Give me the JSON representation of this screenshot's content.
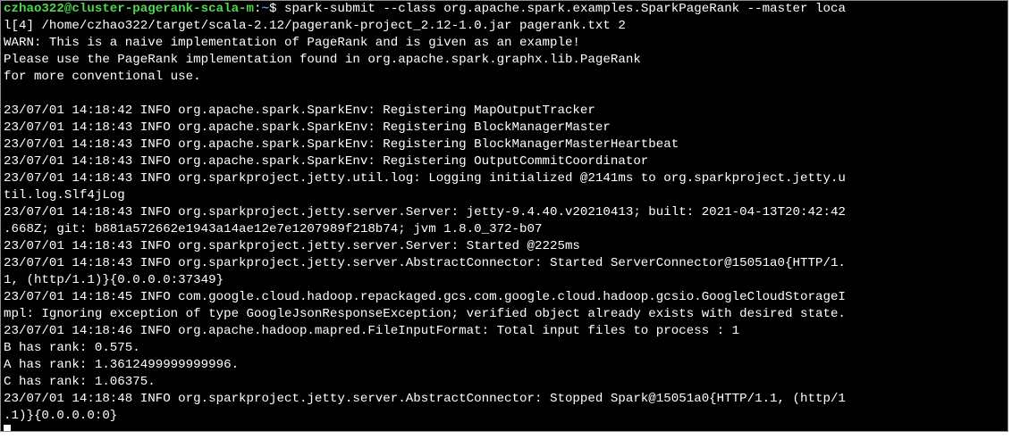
{
  "terminal": {
    "prompt_user_host": "czhao322@cluster-pagerank-scala-m",
    "prompt_sep": ":",
    "prompt_path": "~",
    "prompt_symbol": "$ ",
    "command": "spark-submit --class org.apache.spark.examples.SparkPageRank --master loca",
    "lines": [
      "l[4] /home/czhao322/target/scala-2.12/pagerank-project_2.12-1.0.jar pagerank.txt 2",
      "WARN: This is a naive implementation of PageRank and is given as an example!",
      "Please use the PageRank implementation found in org.apache.spark.graphx.lib.PageRank",
      "for more conventional use.",
      "",
      "23/07/01 14:18:42 INFO org.apache.spark.SparkEnv: Registering MapOutputTracker",
      "23/07/01 14:18:43 INFO org.apache.spark.SparkEnv: Registering BlockManagerMaster",
      "23/07/01 14:18:43 INFO org.apache.spark.SparkEnv: Registering BlockManagerMasterHeartbeat",
      "23/07/01 14:18:43 INFO org.apache.spark.SparkEnv: Registering OutputCommitCoordinator",
      "23/07/01 14:18:43 INFO org.sparkproject.jetty.util.log: Logging initialized @2141ms to org.sparkproject.jetty.u",
      "til.log.Slf4jLog",
      "23/07/01 14:18:43 INFO org.sparkproject.jetty.server.Server: jetty-9.4.40.v20210413; built: 2021-04-13T20:42:42",
      ".668Z; git: b881a572662e1943a14ae12e7e1207989f218b74; jvm 1.8.0_372-b07",
      "23/07/01 14:18:43 INFO org.sparkproject.jetty.server.Server: Started @2225ms",
      "23/07/01 14:18:43 INFO org.sparkproject.jetty.server.AbstractConnector: Started ServerConnector@15051a0{HTTP/1.",
      "1, (http/1.1)}{0.0.0.0:37349}",
      "23/07/01 14:18:45 INFO com.google.cloud.hadoop.repackaged.gcs.com.google.cloud.hadoop.gcsio.GoogleCloudStorageI",
      "mpl: Ignoring exception of type GoogleJsonResponseException; verified object already exists with desired state.",
      "23/07/01 14:18:46 INFO org.apache.hadoop.mapred.FileInputFormat: Total input files to process : 1",
      "B has rank: 0.575.",
      "A has rank: 1.3612499999999996.",
      "C has rank: 1.06375.",
      "23/07/01 14:18:48 INFO org.sparkproject.jetty.server.AbstractConnector: Stopped Spark@15051a0{HTTP/1.1, (http/1",
      ".1)}{0.0.0.0:0}"
    ],
    "colors": {
      "background": "#000000",
      "text": "#ffffff",
      "prompt_user": "#4fd84f",
      "prompt_path": "#5c8cff"
    }
  }
}
